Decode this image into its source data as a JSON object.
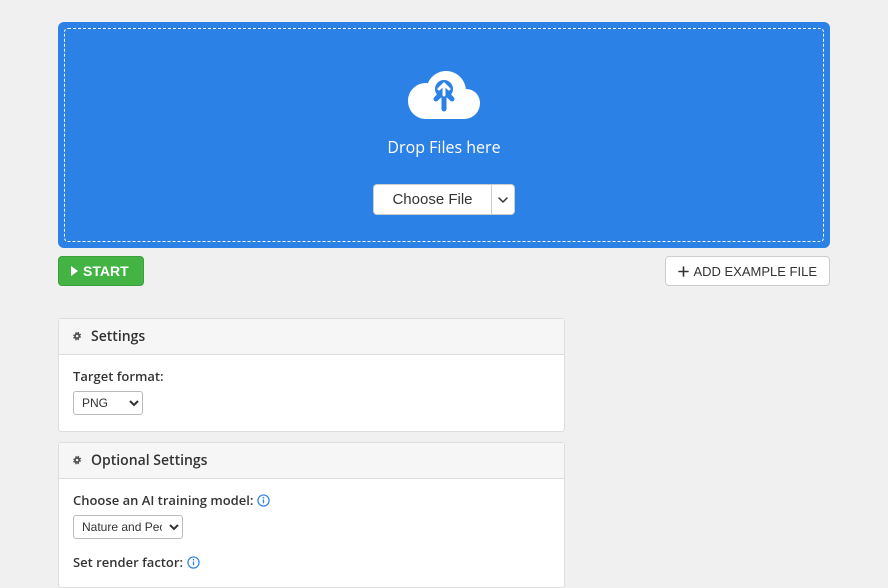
{
  "dropzone": {
    "text": "Drop Files here",
    "choose_label": "Choose File"
  },
  "actions": {
    "start_label": "START",
    "add_example_label": "ADD EXAMPLE FILE"
  },
  "settings": {
    "title": "Settings",
    "target_format_label": "Target format:",
    "target_format_value": "PNG"
  },
  "optional": {
    "title": "Optional Settings",
    "model_label": "Choose an AI training model:",
    "model_value": "Nature and People",
    "render_label": "Set render factor:"
  }
}
